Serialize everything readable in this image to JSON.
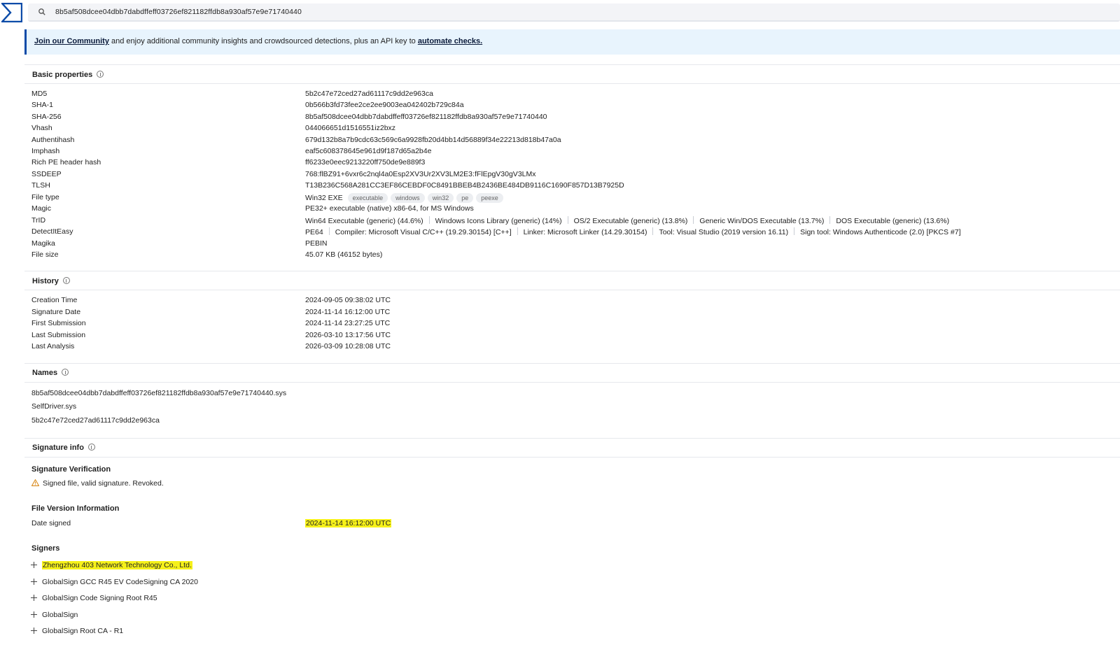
{
  "search": {
    "query": "8b5af508dcee04dbb7dabdffeff03726ef821182ffdb8a930af57e9e71740440"
  },
  "banner": {
    "link1": "Join our Community",
    "middle": " and enjoy additional community insights and crowdsourced detections, plus an API key to ",
    "link2": "automate checks."
  },
  "basic": {
    "title": "Basic properties",
    "rows": [
      {
        "k": "MD5",
        "v": "5b2c47e72ced27ad61117c9dd2e963ca"
      },
      {
        "k": "SHA-1",
        "v": "0b566b3fd73fee2ce2ee9003ea042402b729c84a"
      },
      {
        "k": "SHA-256",
        "v": "8b5af508dcee04dbb7dabdffeff03726ef821182ffdb8a930af57e9e71740440"
      },
      {
        "k": "Vhash",
        "v": "044066651d1516551iz2bxz"
      },
      {
        "k": "Authentihash",
        "v": "679d132b8a7b9cdc63c569c6a9928fb20d4bb14d56889f34e22213d818b47a0a"
      },
      {
        "k": "Imphash",
        "v": "eaf5c608378645e961d9f187d65a2b4e"
      },
      {
        "k": "Rich PE header hash",
        "v": "ff6233e0eec9213220ff750de9e889f3"
      },
      {
        "k": "SSDEEP",
        "v": "768:flBZ91+6vxr6c2nql4a0Esp2XV3Ur2XV3LM2E3:fFlEpgV30gV3LMx"
      },
      {
        "k": "TLSH",
        "v": "T13B236C568A281CC3EF86CEBDF0C8491BBEB4B2436BE484DB9116C1690F857D13B7925D"
      }
    ],
    "filetype": {
      "k": "File type",
      "v": "Win32 EXE",
      "tags": [
        "executable",
        "windows",
        "win32",
        "pe",
        "peexe"
      ]
    },
    "magic": {
      "k": "Magic",
      "v": "PE32+ executable (native) x86-64, for MS Windows"
    },
    "trid": {
      "k": "TrID",
      "items": [
        "Win64 Executable (generic) (44.6%)",
        "Windows Icons Library (generic) (14%)",
        "OS/2 Executable (generic) (13.8%)",
        "Generic Win/DOS Executable (13.7%)",
        "DOS Executable (generic) (13.6%)"
      ]
    },
    "die": {
      "k": "DetectItEasy",
      "items": [
        "PE64",
        "Compiler: Microsoft Visual C/C++ (19.29.30154) [C++]",
        "Linker: Microsoft Linker (14.29.30154)",
        "Tool: Visual Studio (2019 version 16.11)",
        "Sign tool: Windows Authenticode (2.0) [PKCS #7]"
      ]
    },
    "magika": {
      "k": "Magika",
      "v": "PEBIN"
    },
    "filesize": {
      "k": "File size",
      "v": "45.07 KB (46152 bytes)"
    }
  },
  "history": {
    "title": "History",
    "rows": [
      {
        "k": "Creation Time",
        "v": "2024-09-05 09:38:02 UTC"
      },
      {
        "k": "Signature Date",
        "v": "2024-11-14 16:12:00 UTC"
      },
      {
        "k": "First Submission",
        "v": "2024-11-14 23:27:25 UTC"
      },
      {
        "k": "Last Submission",
        "v": "2026-03-10 13:17:56 UTC"
      },
      {
        "k": "Last Analysis",
        "v": "2026-03-09 10:28:08 UTC"
      }
    ]
  },
  "names": {
    "title": "Names",
    "items": [
      "8b5af508dcee04dbb7dabdffeff03726ef821182ffdb8a930af57e9e71740440.sys",
      "SelfDriver.sys",
      "5b2c47e72ced27ad61117c9dd2e963ca"
    ]
  },
  "signature": {
    "title": "Signature info",
    "verification_title": "Signature Verification",
    "verification_text": "Signed file, valid signature. Revoked.",
    "fvi_title": "File Version Information",
    "date_signed_k": "Date signed",
    "date_signed_v": "2024-11-14 16:12:00 UTC",
    "signers_title": "Signers",
    "signers": [
      "Zhengzhou 403 Network Technology Co., Ltd.",
      "GlobalSign GCC R45 EV CodeSigning CA 2020",
      "GlobalSign Code Signing Root R45",
      "GlobalSign",
      "GlobalSign Root CA - R1"
    ]
  },
  "colors": {
    "accent": "#0b4ba8",
    "highlight": "#f6f11a",
    "banner_bg": "#e8f4fd"
  }
}
